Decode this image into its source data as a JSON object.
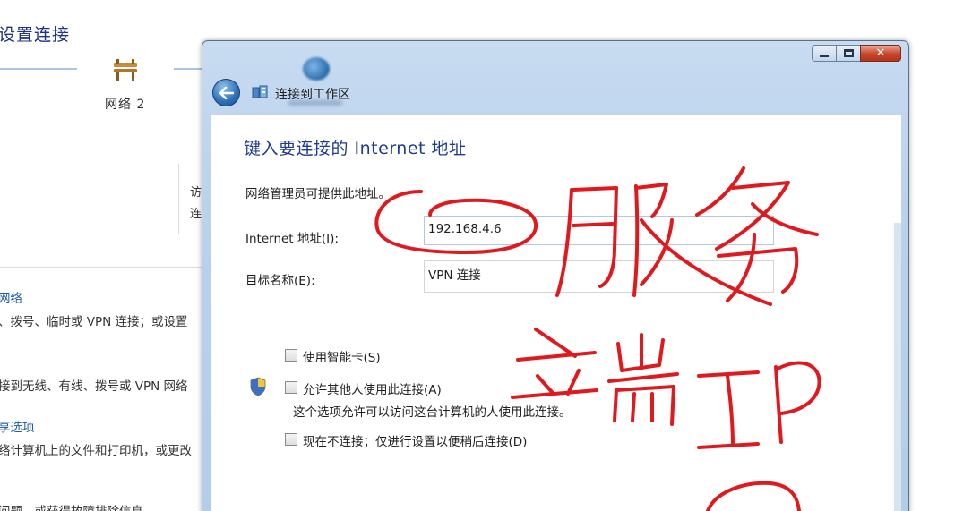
{
  "background_window": {
    "title": "设置连接",
    "network_label": "网络  2",
    "side_text_line1": "访",
    "side_text_line2": "连",
    "link_network": "网络",
    "text_dialup": "、拨号、临时或 VPN 连接；或设置",
    "text_connect": "接到无线、有线、拨号或 VPN 网络",
    "link_sharing": "享选项",
    "text_files": "络计算机上的文件和打印机，或更改",
    "text_bottom": "问题，或获得故障排除信息"
  },
  "dialog": {
    "nav_title": "连接到工作区",
    "heading": "键入要连接的 Internet 地址",
    "hint": "网络管理员可提供此地址。",
    "address_label": "Internet 地址(I):",
    "address_value": "192.168.4.6",
    "name_label": "目标名称(E):",
    "name_value": "VPN 连接",
    "options": {
      "smartcard": "使用智能卡(S)",
      "allow_others": "允许其他人使用此连接(A)",
      "allow_others_desc": "这个选项允许可以访问这台计算机的人使用此连接。",
      "dont_connect": "现在不连接；仅进行设置以便稍后连接(D)"
    },
    "window_buttons": {
      "minimize_icon": "minimize-icon",
      "maximize_icon": "maximize-icon",
      "close_icon": "close-icon"
    }
  },
  "annotation": {
    "handwriting_text": "服务端IP",
    "color": "#e0191f"
  },
  "colors": {
    "heading_blue": "#1e3b8c",
    "link_blue": "#1c5ba8",
    "dialog_frame": "#b9d1ec"
  }
}
